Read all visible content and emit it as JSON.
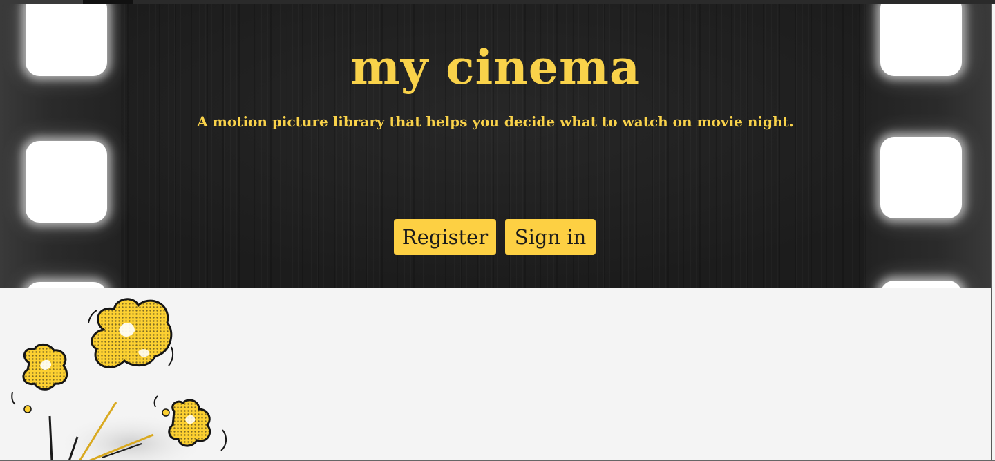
{
  "site": {
    "title": "my cinema",
    "tagline": "A motion picture library that helps you decide what to watch on movie night."
  },
  "actions": {
    "register_label": "Register",
    "signin_label": "Sign in"
  },
  "colors": {
    "accent": "#f9d24a",
    "button_bg": "#fdd043",
    "hero_bg": "#1e1e1e",
    "page_bg": "#f4f4f4"
  },
  "icons": {
    "hero_background": "film-strip-icon",
    "illustration": "popcorn-illustration"
  }
}
